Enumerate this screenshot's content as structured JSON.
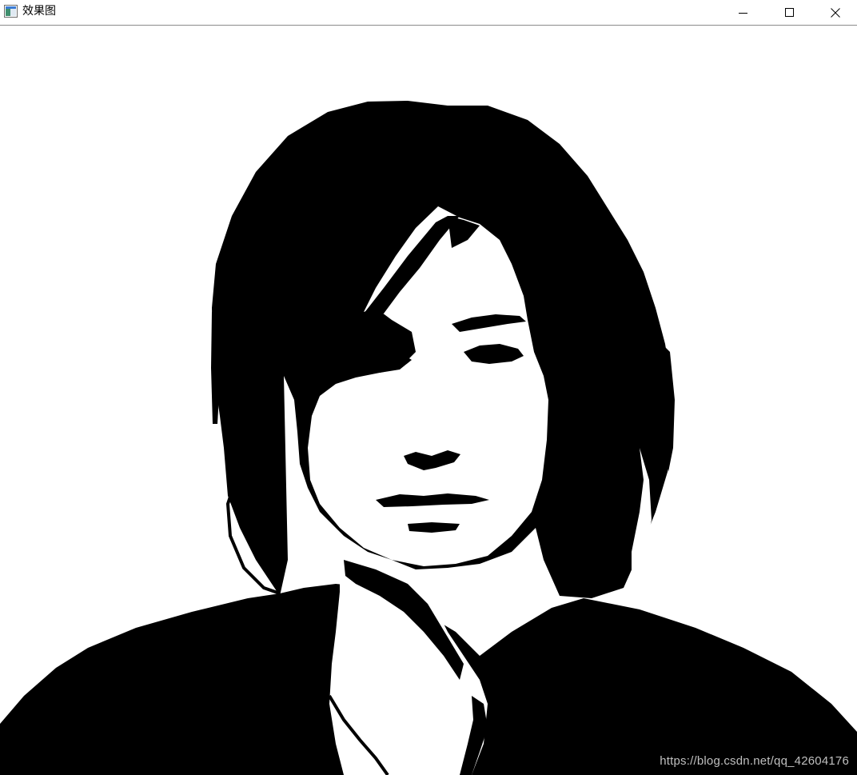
{
  "window": {
    "title": "效果图",
    "app_icon": "opencv-window-icon",
    "controls": {
      "minimize_icon": "minimize-icon",
      "maximize_icon": "maximize-icon",
      "close_icon": "close-icon"
    }
  },
  "image": {
    "description_icon": "binary-threshold-portrait",
    "foreground_color": "#000000",
    "background_color": "#ffffff"
  },
  "watermark": {
    "text": "https://blog.csdn.net/qq_42604176"
  }
}
